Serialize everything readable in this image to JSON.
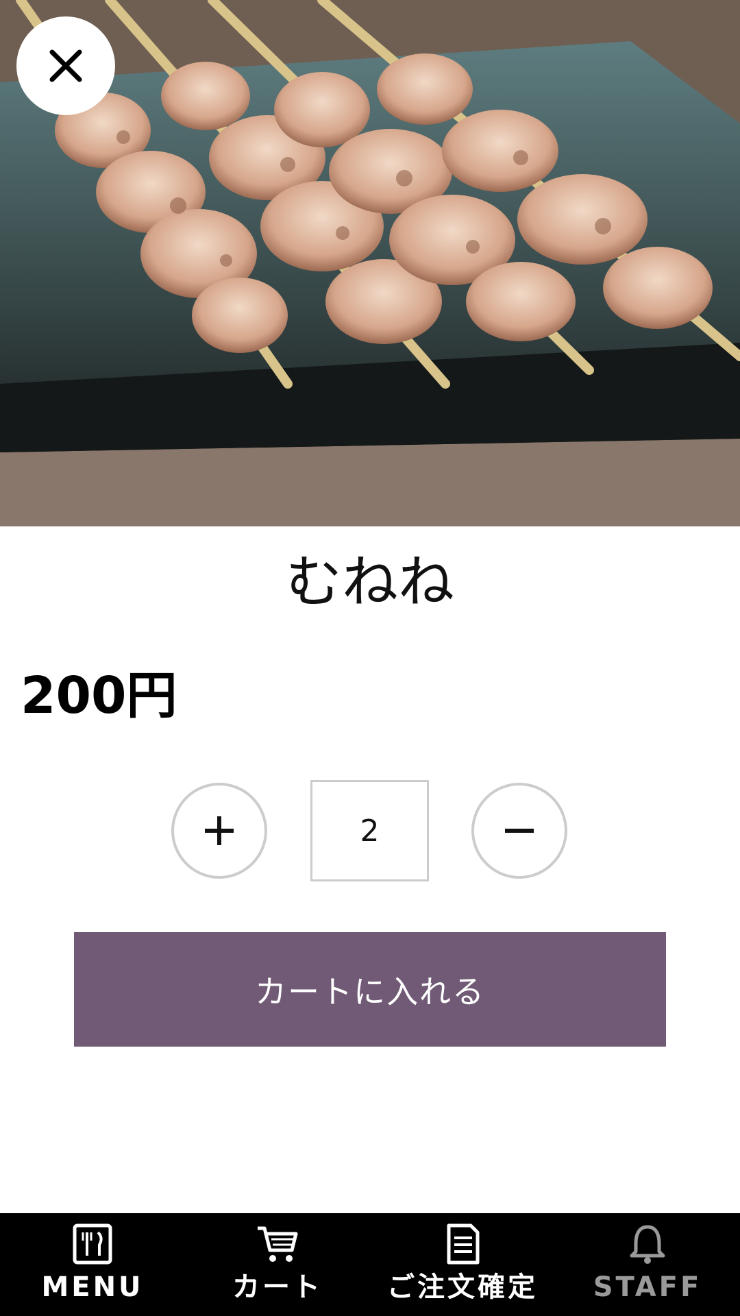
{
  "item": {
    "name": "むねね",
    "price": "200円",
    "quantity": "2",
    "image": "grilled-chicken-skewers-photo"
  },
  "controls": {
    "close_icon": "close-icon",
    "increase_symbol": "+",
    "decrease_symbol": "−",
    "add_to_cart_label": "カートに入れる"
  },
  "nav": {
    "items": [
      {
        "label": "MENU",
        "icon": "menu-icon"
      },
      {
        "label": "カート",
        "icon": "cart-icon"
      },
      {
        "label": "ご注文確定",
        "icon": "order-confirm-icon"
      },
      {
        "label": "STAFF",
        "icon": "bell-icon"
      }
    ]
  },
  "colors": {
    "accent": "#715a75",
    "nav_background": "#000000",
    "staff_disabled": "#9a9a9a"
  }
}
